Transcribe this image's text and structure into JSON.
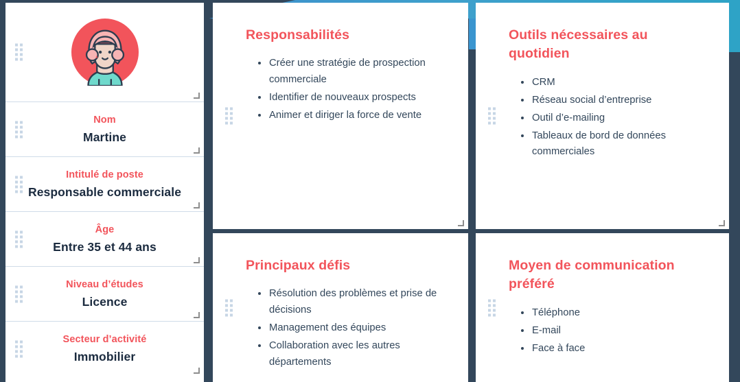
{
  "theme": {
    "background_navy": "#33475b",
    "accent_coral": "#f2545b",
    "accent_blue": "#2ea3c6",
    "text_navy": "#33475b",
    "avatar_circle": "#f2545b",
    "avatar_hair": "#f7b4b4",
    "avatar_shirt": "#6fd9cc"
  },
  "profile": {
    "avatar_icon": "woman-avatar-icon",
    "fields": [
      {
        "label": "Nom",
        "value": "Martine"
      },
      {
        "label": "Intitulé de poste",
        "value": "Responsable commerciale"
      },
      {
        "label": "Âge",
        "value": "Entre 35 et 44 ans"
      },
      {
        "label": "Niveau d’études",
        "value": "Licence"
      },
      {
        "label": "Secteur d’activité",
        "value": "Immobilier"
      }
    ]
  },
  "cards": [
    {
      "id": "responsabilites",
      "title": "Responsabilités",
      "items": [
        "Créer une stratégie de prospection commerciale",
        "Identifier de nouveaux prospects",
        "Animer et diriger la force de vente"
      ]
    },
    {
      "id": "outils",
      "title": "Outils nécessaires au quotidien",
      "items": [
        "CRM",
        "Réseau social d’entreprise",
        "Outil d’e-mailing",
        "Tableaux de bord de données commerciales"
      ]
    },
    {
      "id": "defis",
      "title": "Principaux défis",
      "items": [
        "Résolution des problèmes et prise de décisions",
        "Management des équipes",
        "Collaboration avec les autres départements"
      ]
    },
    {
      "id": "communication",
      "title": "Moyen de communication préféré",
      "items": [
        "Téléphone",
        "E-mail",
        "Face à face"
      ]
    }
  ]
}
